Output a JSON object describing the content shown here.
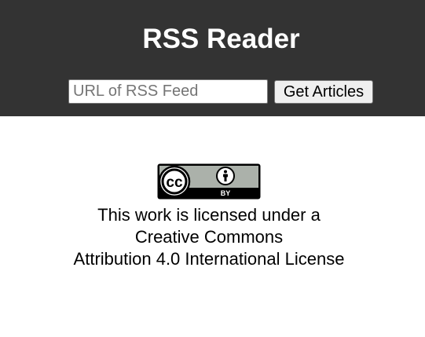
{
  "header": {
    "title": "RSS Reader",
    "background": "#333333"
  },
  "feed_form": {
    "input_value": "",
    "input_placeholder": "URL of RSS Feed",
    "submit_label": "Get Articles"
  },
  "license": {
    "badge_icons": [
      "creative-commons-icon",
      "attribution-icon"
    ],
    "badge_label": "BY",
    "line1": "This work is licensed under a",
    "line2": "Creative Commons",
    "line3": "Attribution 4.0 International License"
  }
}
